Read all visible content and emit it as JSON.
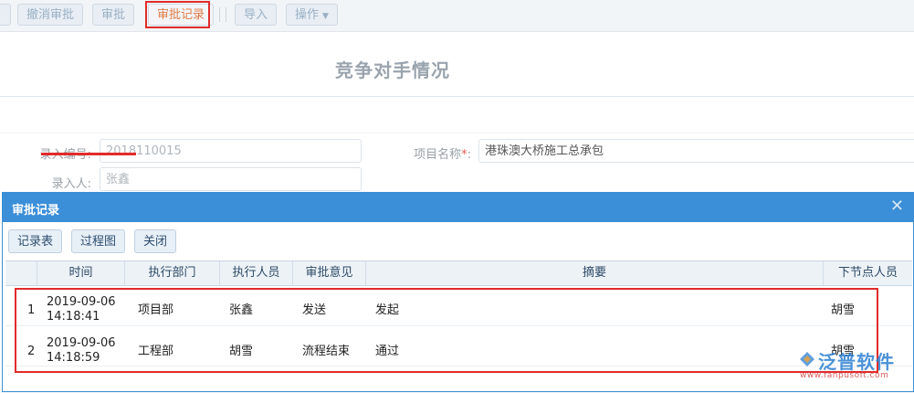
{
  "toolbar": {
    "buttons": [
      {
        "label": "撤消审批"
      },
      {
        "label": "审批"
      },
      {
        "label": "审批记录"
      },
      {
        "label": "导入"
      },
      {
        "label": "操作"
      }
    ]
  },
  "form": {
    "title": "竞争对手情况",
    "entry_no_label": "录入编号:",
    "entry_no_value": "2018110015",
    "entry_person_label": "录入人:",
    "entry_person_value": "张鑫",
    "project_name_label": "项目名称",
    "required_mark": "*",
    "colon": ":",
    "project_name_value": "港珠澳大桥施工总承包"
  },
  "modal": {
    "title": "审批记录",
    "close_glyph": "✕",
    "buttons": [
      {
        "label": "记录表"
      },
      {
        "label": "过程图"
      },
      {
        "label": "关闭"
      }
    ],
    "table": {
      "headers": [
        "时间",
        "执行部门",
        "执行人员",
        "审批意见",
        "摘要",
        "下节点人员"
      ],
      "rows": [
        {
          "index": "1",
          "date": "2019-09-06",
          "time": "14:18:41",
          "dept": "项目部",
          "person": "张鑫",
          "opinion": "发送",
          "summary": "发起",
          "next": "胡雪"
        },
        {
          "index": "2",
          "date": "2019-09-06",
          "time": "14:18:59",
          "dept": "工程部",
          "person": "胡雪",
          "opinion": "流程结束",
          "summary": "通过",
          "next": "胡雪"
        }
      ]
    }
  },
  "logo": {
    "name": "泛普软件",
    "url": "www.fanpusoft.com"
  },
  "colors": {
    "accent": "#3b8ed8",
    "highlight": "#e12b2b",
    "active_text": "#e07a45"
  }
}
